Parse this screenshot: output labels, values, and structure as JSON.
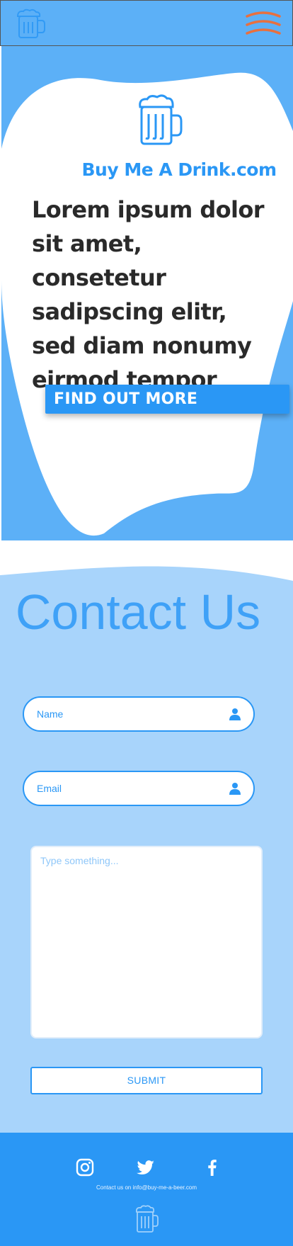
{
  "header": {
    "logo_icon": "beer-mug-icon",
    "menu_icon": "hamburger-menu-icon",
    "menu_color": "#e8703f"
  },
  "hero": {
    "site_name": "Buy Me A Drink.com",
    "headline": "Lorem ipsum dolor sit amet, consetetur sadipscing elitr, sed diam nonumy eirmod tempor",
    "cta_label": "FIND OUT MORE"
  },
  "contact": {
    "title": "Contact Us",
    "name_placeholder": "Name",
    "email_placeholder": "Email",
    "message_placeholder": "Type something...",
    "submit_label": "SUBMIT"
  },
  "footer": {
    "social": [
      "instagram-icon",
      "twitter-icon",
      "facebook-icon"
    ],
    "contact_line": "Contact us on info@buy-me-a-beer.com"
  },
  "colors": {
    "primary": "#2a97f5",
    "hero_bg": "#5cb0f7",
    "contact_bg": "#a8d4fb",
    "text_dark": "#2a2a2a"
  }
}
